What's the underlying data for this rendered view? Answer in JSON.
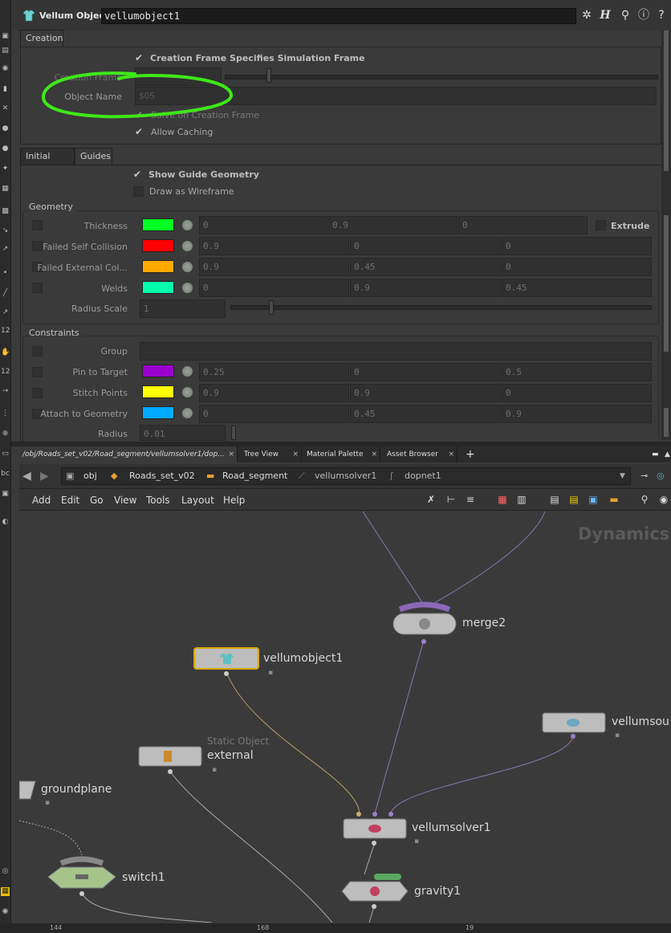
{
  "header": {
    "node_type": "Vellum Object",
    "node_name": "vellumobject1",
    "icons": [
      "gear-icon",
      "help-h-icon",
      "search-icon",
      "info-icon",
      "question-icon"
    ]
  },
  "tabs_top": [
    "Creation"
  ],
  "creation": {
    "creation_frame_specifies": "Creation Frame Specifies Simulation Frame",
    "creation_frame_label": "Creation Frame",
    "object_name_label": "Object Name",
    "object_name_value": "$OS",
    "solve_on_creation": "Solve on Creation Frame",
    "allow_caching": "Allow Caching"
  },
  "tabs_mid": [
    "Initial Data",
    "Guides"
  ],
  "guides": {
    "show_guide": "Show Guide Geometry",
    "draw_wireframe": "Draw as Wireframe"
  },
  "geometry": {
    "title": "Geometry",
    "rows": [
      {
        "label": "Thickness",
        "color": "#00ff22",
        "values": [
          "0",
          "0.9",
          "0"
        ]
      },
      {
        "label": "Failed Self Collision",
        "color": "#ff0000",
        "values": [
          "0.9",
          "0",
          "0"
        ]
      },
      {
        "label": "Failed External Col...",
        "color": "#ffaa00",
        "values": [
          "0.9",
          "0.45",
          "0"
        ]
      },
      {
        "label": "Welds",
        "color": "#00ffaa",
        "values": [
          "0",
          "0.9",
          "0.45"
        ]
      }
    ],
    "extrude_label": "Extrude",
    "radius_label": "Radius Scale",
    "radius_value": "1"
  },
  "constraints": {
    "title": "Constraints",
    "group_label": "Group",
    "rows": [
      {
        "label": "Pin to Target",
        "color": "#9900cc",
        "values": [
          "0.25",
          "0",
          "0.5"
        ]
      },
      {
        "label": "Stitch Points",
        "color": "#ffff00",
        "values": [
          "0.9",
          "0.9",
          "0"
        ]
      },
      {
        "label": "Attach to Geometry",
        "color": "#00aaff",
        "values": [
          "0",
          "0.45",
          "0.9"
        ]
      }
    ],
    "radius_label": "Radius",
    "radius_value": "0.01"
  },
  "net_tabs": [
    "/obj/Roads_set_v02/Road_segment/vellumsolver1/dop...",
    "Tree View",
    "Material Palette",
    "Asset Browser"
  ],
  "path": [
    "obj",
    "Roads_set_v02",
    "Road_segment",
    "vellumsolver1",
    "dopnet1"
  ],
  "menus": [
    "Add",
    "Edit",
    "Go",
    "View",
    "Tools",
    "Layout",
    "Help"
  ],
  "canvas": {
    "context_label": "Dynamics",
    "nodes": {
      "merge": "merge2",
      "vellumobject": "vellumobject1",
      "vellumsource": "vellumsou",
      "external_sub": "Static Object",
      "external": "external",
      "groundplane": "groundplane",
      "solver": "vellumsolver1",
      "switch": "switch1",
      "gravity": "gravity1"
    }
  },
  "ruler": [
    "144",
    "168",
    "19"
  ]
}
